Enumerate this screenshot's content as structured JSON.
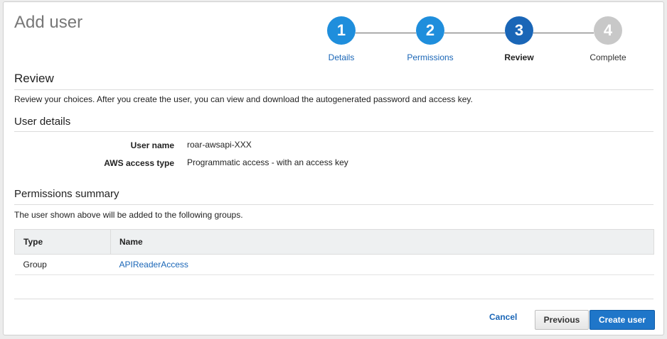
{
  "page_title": "Add user",
  "steps": [
    {
      "number": "1",
      "label": "Details",
      "state": "done"
    },
    {
      "number": "2",
      "label": "Permissions",
      "state": "done"
    },
    {
      "number": "3",
      "label": "Review",
      "state": "current"
    },
    {
      "number": "4",
      "label": "Complete",
      "state": "todo"
    }
  ],
  "review": {
    "title": "Review",
    "description": "Review your choices. After you create the user, you can view and download the autogenerated password and access key."
  },
  "user_details": {
    "title": "User details",
    "rows": [
      {
        "label": "User name",
        "value": "roar-awsapi-XXX"
      },
      {
        "label": "AWS access type",
        "value": "Programmatic access - with an access key"
      }
    ]
  },
  "permissions_summary": {
    "title": "Permissions summary",
    "description": "The user shown above will be added to the following groups.",
    "columns": [
      "Type",
      "Name"
    ],
    "rows": [
      {
        "type": "Group",
        "name": "APIReaderAccess"
      }
    ]
  },
  "actions": {
    "cancel": "Cancel",
    "previous": "Previous",
    "create": "Create user"
  },
  "colors": {
    "accent": "#1f8edc",
    "current_step": "#1a66b7",
    "primary_button": "#1f76c9"
  }
}
